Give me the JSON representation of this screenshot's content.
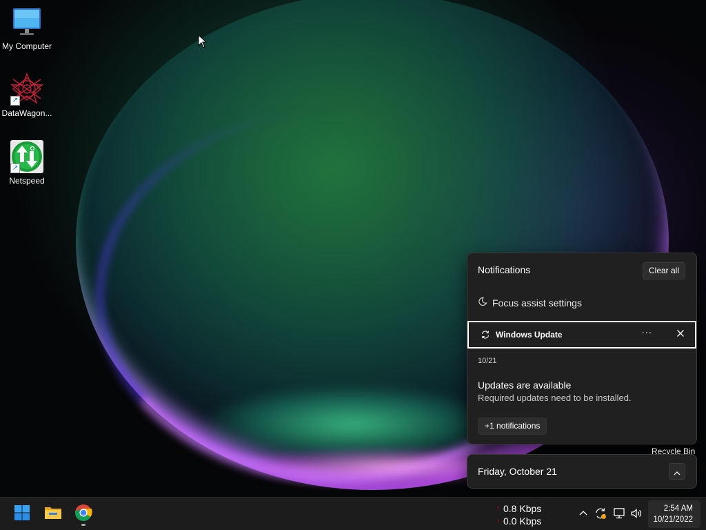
{
  "desktop": {
    "icons": [
      {
        "label": "My Computer",
        "icon": "monitor-icon"
      },
      {
        "label": "DataWagon...",
        "icon": "datawagon-icon"
      },
      {
        "label": "Netspeed",
        "icon": "netspeed-icon"
      }
    ],
    "recycle_bin_label": "Recycle Bin"
  },
  "notification_center": {
    "title": "Notifications",
    "clear_all_label": "Clear all",
    "focus_assist_label": "Focus assist settings",
    "app_group": {
      "app_name": "Windows Update",
      "more_label": "···",
      "icon": "sync-icon"
    },
    "notification": {
      "date": "10/21",
      "title": "Updates are available",
      "body": "Required updates need to be installed."
    },
    "more_notifications_label": "+1 notifications"
  },
  "calendar": {
    "date_label": "Friday, October 21"
  },
  "taskbar": {
    "pinned": [
      {
        "name": "start",
        "icon": "windows-logo-icon"
      },
      {
        "name": "file-explorer",
        "icon": "folder-icon"
      },
      {
        "name": "chrome",
        "icon": "chrome-icon"
      }
    ],
    "netspeed": {
      "upload": "0.8 Kbps",
      "download": "0.0 Kbps",
      "up_arrow": "↑",
      "down_arrow": "↓"
    },
    "tray_icons": [
      "chevron-up-icon",
      "windows-update-icon",
      "network-icon",
      "volume-icon"
    ],
    "clock": {
      "time": "2:54 AM",
      "date": "10/21/2022"
    }
  },
  "colors": {
    "panel_bg": "#202020",
    "taskbar_bg": "#1c1c1c",
    "accent_blue": "#0078d4"
  }
}
